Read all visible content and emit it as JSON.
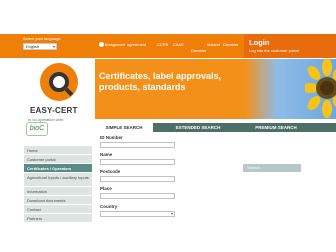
{
  "topbar": {
    "language_label": "Select your language",
    "language_value": "English",
    "partners": [
      "bioagrocert",
      "agreement",
      "CCPB",
      "CAAE",
      "Demeter",
      "bioland",
      "Demeter"
    ]
  },
  "login": {
    "title": "Login",
    "subtitle": "Log into the customer portal"
  },
  "logo": {
    "text": "EASY-CERT"
  },
  "hero": {
    "headline": "Certificates, label approvals, products, standards"
  },
  "cooperation": {
    "label": "In co-operation with:",
    "partner": "bioC"
  },
  "sidebar": {
    "items": [
      {
        "label": "Home"
      },
      {
        "label": "Customer portal"
      },
      {
        "label": "Certificates / Operators"
      },
      {
        "label": "Agricultural Inputs / auxiliary inputs"
      },
      {
        "label": "Information"
      },
      {
        "label": "Download documents"
      },
      {
        "label": "Contact"
      },
      {
        "label": "Partners"
      }
    ]
  },
  "tabs": [
    {
      "label": "SIMPLE SEARCH"
    },
    {
      "label": "EXTENDED SEARCH"
    },
    {
      "label": "PREMIUM SEARCH"
    }
  ],
  "form": {
    "id_label": "ID Number",
    "name_label": "Name",
    "postcode_label": "Postcode",
    "place_label": "Place",
    "country_label": "Country",
    "country_value": "",
    "search_button": "Search"
  },
  "colors": {
    "brand_orange": "#f07f0a",
    "nav_teal": "#5a8c86",
    "tab_bar": "#4e6f68"
  }
}
